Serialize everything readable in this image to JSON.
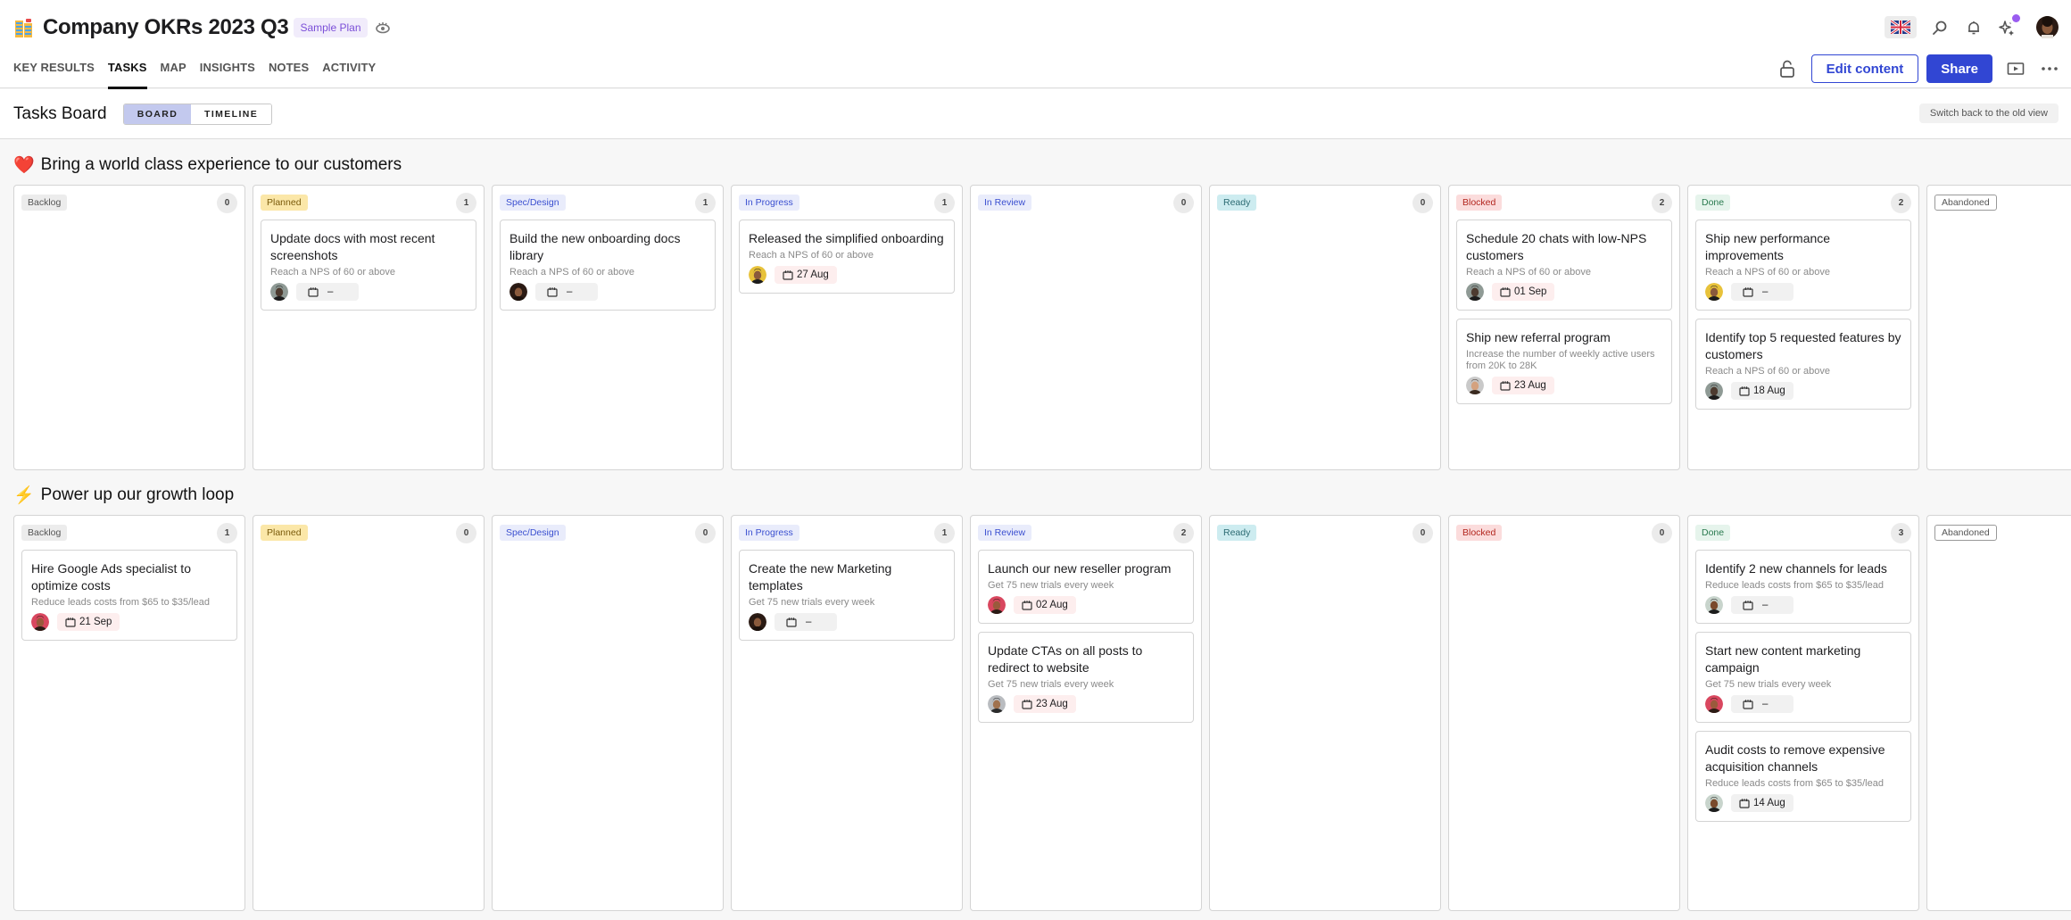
{
  "header": {
    "title": "Company OKRs 2023 Q3",
    "title_emoji": "building-icon",
    "badge": "Sample Plan",
    "tabs": [
      {
        "label": "KEY RESULTS",
        "active": false
      },
      {
        "label": "TASKS",
        "active": true
      },
      {
        "label": "MAP",
        "active": false
      },
      {
        "label": "INSIGHTS",
        "active": false
      },
      {
        "label": "NOTES",
        "active": false
      },
      {
        "label": "ACTIVITY",
        "active": false
      }
    ],
    "edit_label": "Edit content",
    "share_label": "Share",
    "accent": "#3146d3"
  },
  "board": {
    "title": "Tasks Board",
    "views": [
      "BOARD",
      "TIMELINE"
    ],
    "active_view": "BOARD",
    "old_view_label": "Switch back to the old view"
  },
  "statuses": [
    {
      "label": "Backlog",
      "bg": "#ececec",
      "fg": "#555555"
    },
    {
      "label": "Planned",
      "bg": "#fbe7a8",
      "fg": "#7a5a0a"
    },
    {
      "label": "Spec/Design",
      "bg": "#e9ecfb",
      "fg": "#3a4fd0"
    },
    {
      "label": "In Progress",
      "bg": "#e9ecfb",
      "fg": "#3a4fd0"
    },
    {
      "label": "In Review",
      "bg": "#e9ecfb",
      "fg": "#3a4fd0"
    },
    {
      "label": "Ready",
      "bg": "#cdecf0",
      "fg": "#2b6a72"
    },
    {
      "label": "Blocked",
      "bg": "#fbdcdc",
      "fg": "#b3261e"
    },
    {
      "label": "Done",
      "bg": "#e6f4ec",
      "fg": "#2a7a4f"
    },
    {
      "label": "Abandoned",
      "bg": "#ffffff",
      "fg": "#555555",
      "outlined": true
    }
  ],
  "sections": [
    {
      "title": "Bring a world class experience to our customers",
      "emoji": "❤️",
      "columns": [
        {
          "count": "0",
          "cards": []
        },
        {
          "count": "1",
          "cards": [
            {
              "title": "Update docs with most recent screenshots",
              "kr": "Reach a NPS of 60 or above",
              "avatar": "a2",
              "date": "–",
              "date_state": "none"
            }
          ]
        },
        {
          "count": "1",
          "cards": [
            {
              "title": "Build the new onboarding docs library",
              "kr": "Reach a NPS of 60 or above",
              "avatar": "a1",
              "date": "–",
              "date_state": "none"
            }
          ]
        },
        {
          "count": "1",
          "cards": [
            {
              "title": "Released the simplified onboarding",
              "kr": "Reach a NPS of 60 or above",
              "avatar": "a3",
              "date": "27 Aug",
              "date_state": "overdue"
            }
          ]
        },
        {
          "count": "0",
          "cards": []
        },
        {
          "count": "0",
          "cards": []
        },
        {
          "count": "2",
          "cards": [
            {
              "title": "Schedule 20 chats with low-NPS customers",
              "kr": "Reach a NPS of 60 or above",
              "avatar": "a2",
              "date": "01 Sep",
              "date_state": "overdue"
            },
            {
              "title": "Ship new referral program",
              "kr": "Increase the number of weekly active users from 20K to 28K",
              "avatar": "a4",
              "date": "23 Aug",
              "date_state": "overdue"
            }
          ]
        },
        {
          "count": "2",
          "cards": [
            {
              "title": "Ship new performance improvements",
              "kr": "Reach a NPS of 60 or above",
              "avatar": "a3",
              "date": "–",
              "date_state": "none"
            },
            {
              "title": "Identify top 5 requested features by customers",
              "kr": "Reach a NPS of 60 or above",
              "avatar": "a2",
              "date": "18 Aug",
              "date_state": "plain"
            }
          ]
        },
        {
          "count": null,
          "cards": []
        }
      ]
    },
    {
      "title": "Power up our growth loop",
      "emoji": "⚡",
      "columns": [
        {
          "count": "1",
          "cards": [
            {
              "title": "Hire Google Ads specialist to optimize costs",
              "kr": "Reduce leads costs from $65 to $35/lead",
              "avatar": "a5",
              "date": "21 Sep",
              "date_state": "overdue"
            }
          ]
        },
        {
          "count": "0",
          "cards": []
        },
        {
          "count": "0",
          "cards": []
        },
        {
          "count": "1",
          "cards": [
            {
              "title": "Create the new Marketing templates",
              "kr": "Get 75 new trials every week",
              "avatar": "a1",
              "date": "–",
              "date_state": "none"
            }
          ]
        },
        {
          "count": "2",
          "cards": [
            {
              "title": "Launch our new reseller program",
              "kr": "Get 75 new trials every week",
              "avatar": "a5",
              "date": "02 Aug",
              "date_state": "overdue"
            },
            {
              "title": "Update CTAs on all posts to redirect to website",
              "kr": "Get 75 new trials every week",
              "avatar": "a6",
              "date": "23 Aug",
              "date_state": "overdue"
            }
          ]
        },
        {
          "count": "0",
          "cards": []
        },
        {
          "count": "0",
          "cards": []
        },
        {
          "count": "3",
          "cards": [
            {
              "title": "Identify 2 new channels for leads",
              "kr": "Reduce leads costs from $65 to $35/lead",
              "avatar": "a7",
              "date": "–",
              "date_state": "none"
            },
            {
              "title": "Start new content marketing campaign",
              "kr": "Get 75 new trials every week",
              "avatar": "a5",
              "date": "–",
              "date_state": "none"
            },
            {
              "title": "Audit costs to remove expensive acquisition channels",
              "kr": "Reduce leads costs from $65 to $35/lead",
              "avatar": "a7",
              "date": "14 Aug",
              "date_state": "plain"
            }
          ]
        },
        {
          "count": null,
          "cards": []
        }
      ]
    }
  ]
}
